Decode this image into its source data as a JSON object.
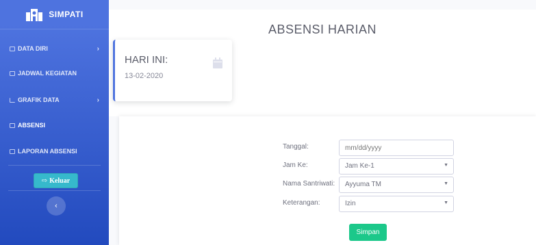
{
  "sidebar": {
    "brand": "SIMPATI",
    "items": [
      {
        "label": "DATA DIRI",
        "icon": "table-icon",
        "has_arrow": true
      },
      {
        "label": "JADWAL KEGIATAN",
        "icon": "table-icon",
        "has_arrow": false
      },
      {
        "label": "GRAFIK DATA",
        "icon": "chart-icon",
        "has_arrow": true
      },
      {
        "label": "ABSENSI",
        "icon": "table-icon",
        "has_arrow": false
      },
      {
        "label": "LAPORAN ABSENSI",
        "icon": "table-icon",
        "has_arrow": false
      }
    ],
    "logout_label": "Keluar",
    "toggle_symbol": "‹"
  },
  "header": {
    "title": "ABSENSI HARIAN"
  },
  "today_card": {
    "label": "HARI INI:",
    "date": "13-02-2020"
  },
  "form": {
    "tanggal": {
      "label": "Tanggal:",
      "placeholder": "mm/dd/yyyy"
    },
    "jam_ke": {
      "label": "Jam Ke:",
      "value": "Jam Ke-1"
    },
    "nama": {
      "label": "Nama Santriwati:",
      "value": "Ayyuma TM"
    },
    "keterangan": {
      "label": "Keterangan:",
      "value": "Izin"
    },
    "submit_label": "Simpan"
  },
  "colors": {
    "sidebar_primary": "#4e73df",
    "logout": "#36b9cc",
    "submit": "#1cc88a"
  }
}
